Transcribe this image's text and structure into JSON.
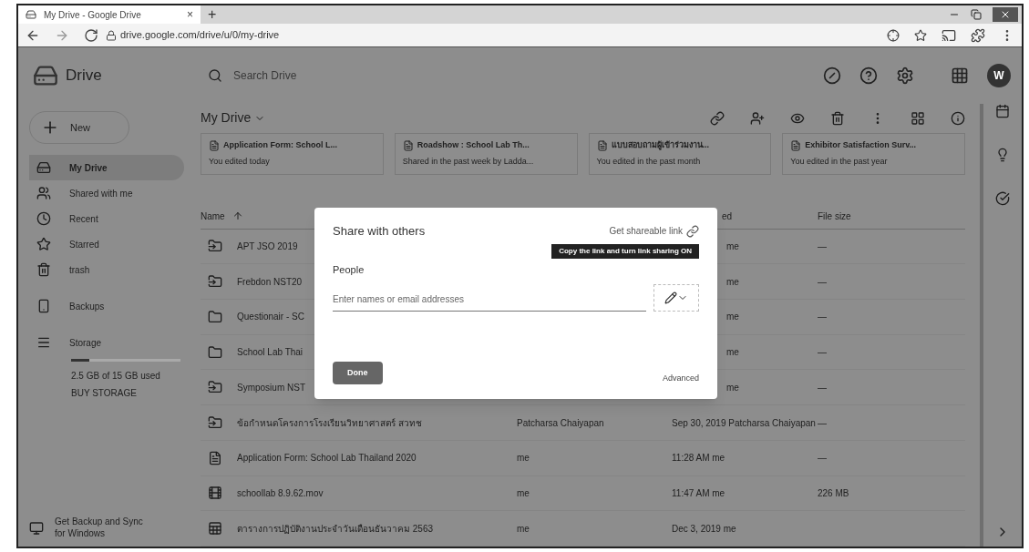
{
  "browser": {
    "tab": {
      "title": "My Drive - Google Drive",
      "close": "×"
    },
    "new_tab": "+",
    "url": "drive.google.com/drive/u/0/my-drive"
  },
  "app": {
    "name": "Drive",
    "search": {
      "placeholder": "Search Drive"
    },
    "avatar": "W"
  },
  "sidebar": {
    "new_button": "New",
    "items": [
      {
        "label": "My Drive",
        "selected": true
      },
      {
        "label": "Shared with me",
        "selected": false
      },
      {
        "label": "Recent",
        "selected": false
      },
      {
        "label": "Starred",
        "selected": false
      },
      {
        "label": "trash",
        "selected": false
      },
      {
        "label": "Backups",
        "selected": false
      },
      {
        "label": "Storage",
        "selected": false
      }
    ],
    "storage": {
      "level": 0.17,
      "usage": "2.5 GB of 15 GB used",
      "buy": "BUY STORAGE"
    },
    "promo": "Get Backup and Sync for Windows"
  },
  "content": {
    "title": "My Drive",
    "quick_access": [
      {
        "title": "Application Form: School L...",
        "subtitle": "You edited today"
      },
      {
        "title": "Roadshow : School Lab Th...",
        "subtitle": "Shared in the past week by Ladda..."
      },
      {
        "title": "แบบสอบถามผู้เข้าร่วมงาน...",
        "subtitle": "You edited in the past month"
      },
      {
        "title": "Exhibitor Satisfaction Surv...",
        "subtitle": "You edited in the past year"
      }
    ],
    "name_column": "Name",
    "modified_column": "ed",
    "size_column": "File size",
    "rows": [
      {
        "kind": "behind_dialog",
        "name": "APT JSO 2019",
        "modified": "me",
        "size": "—"
      },
      {
        "kind": "behind_dialog",
        "name": "Frebdon NST20",
        "modified": "me",
        "size": "—"
      },
      {
        "kind": "behind_dialog",
        "name": "Questionair - SC",
        "modified": "me",
        "size": "—"
      },
      {
        "kind": "behind_dialog",
        "name": "School Lab Thai",
        "modified": "me",
        "size": "—"
      },
      {
        "kind": "behind_dialog",
        "name": "Symposium NST",
        "modified": "me",
        "size": "—"
      },
      {
        "kind": "normal",
        "name": "ข้อกำหนดโครงการโรงเรียนวิทยาศาสตร์ สวทช",
        "owner": "Patcharsa Chaiyapan",
        "modified": "Sep 30, 2019 Patcharsa Chaiyapan",
        "size": "—"
      },
      {
        "kind": "normal",
        "name": "Application Form: School Lab Thailand 2020",
        "owner": "me",
        "modified": "11:28 AM me",
        "size": "—"
      },
      {
        "kind": "normal",
        "name": "schoollab 8.9.62.mov",
        "owner": "me",
        "modified": "11:47 AM me",
        "size": "226 MB"
      },
      {
        "kind": "normal",
        "name": "ตารางการปฏิบัติงานประจำวันเดือนธันวาคม 2563",
        "owner": "me",
        "modified": "Dec 3, 2019 me"
      }
    ]
  },
  "dialog": {
    "title": "Share with others",
    "link_label": "Get shareable link",
    "tooltip": "Copy the link and turn link sharing ON",
    "people_label": "People",
    "input": {
      "placeholder": "Enter names or email addresses"
    },
    "done": "Done",
    "advanced": "Advanced"
  }
}
